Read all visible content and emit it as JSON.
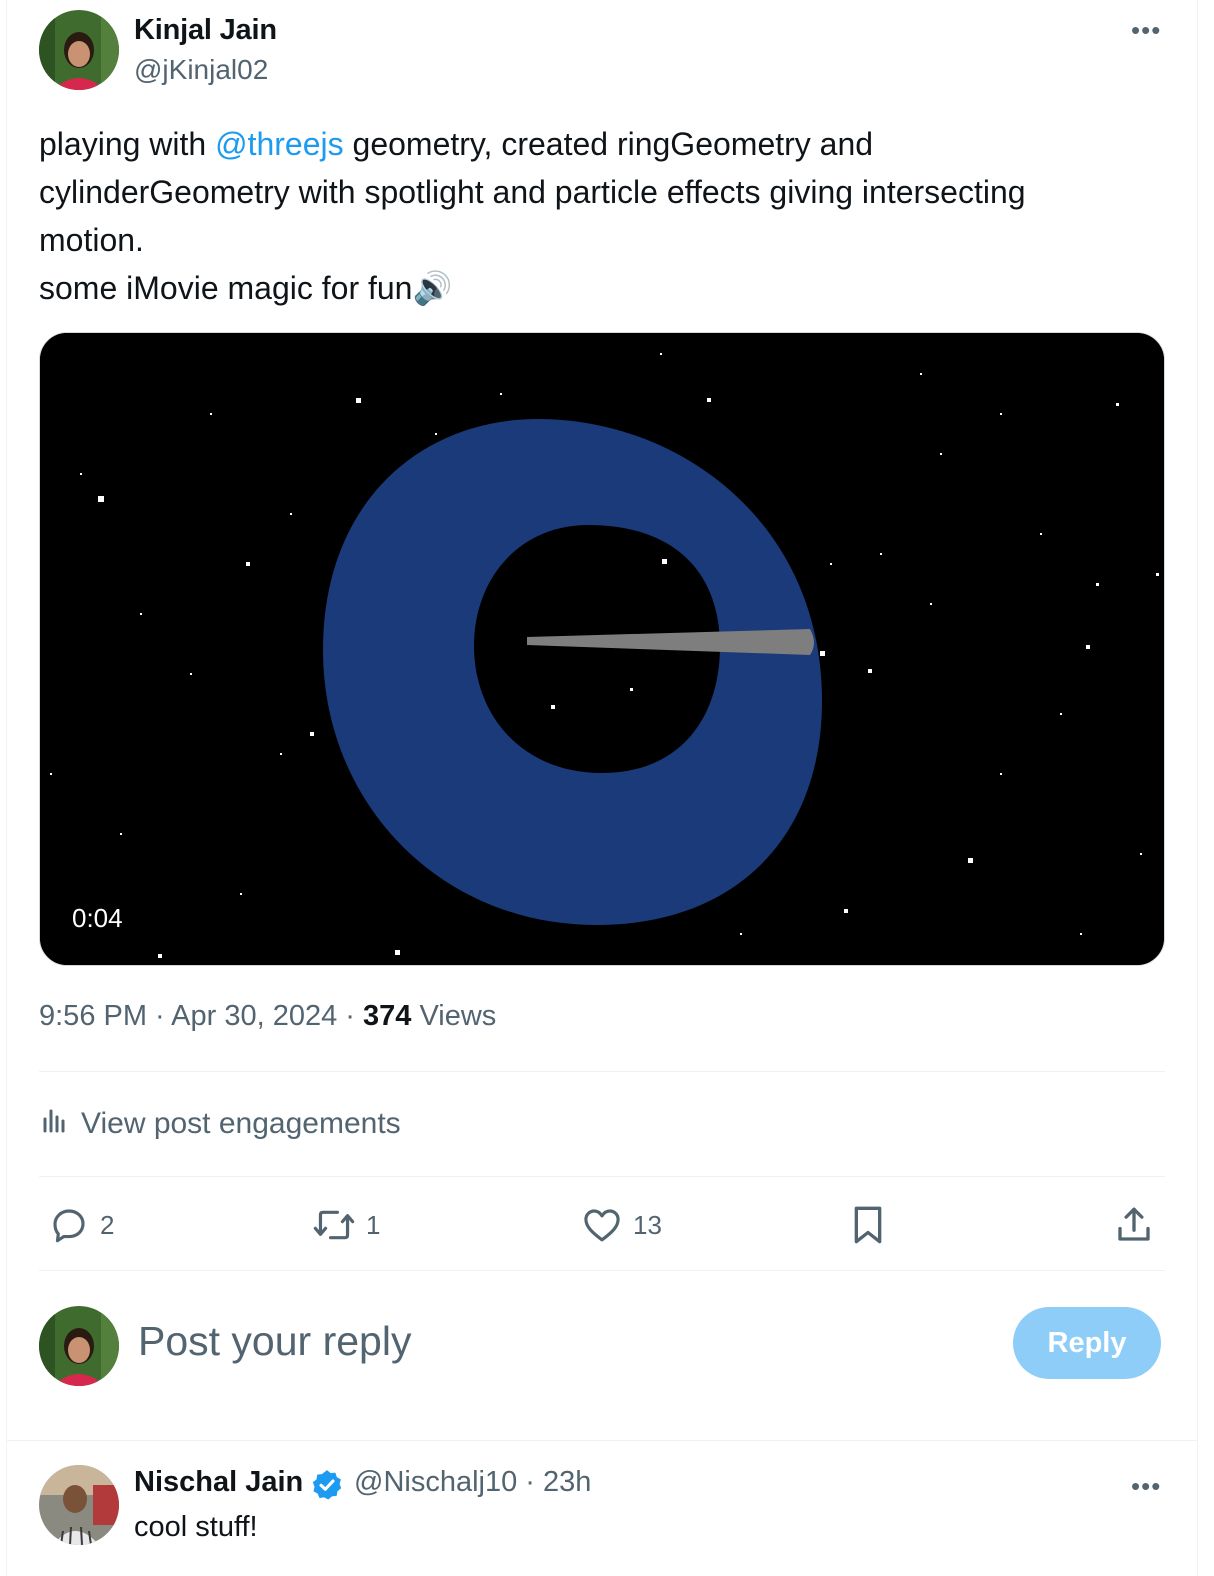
{
  "post": {
    "author": {
      "name": "Kinjal Jain",
      "handle": "@jKinjal02"
    },
    "text": {
      "line1_before": "playing with ",
      "mention": "@threejs",
      "line1_after": " geometry, created ringGeometry and",
      "line2": "cylinderGeometry with spotlight and particle effects giving intersecting",
      "line3": "motion.",
      "line4": " some iMovie magic for fun🔊"
    },
    "video": {
      "duration": "0:04"
    },
    "meta": {
      "time": "9:56 PM",
      "separator1": " · ",
      "date": "Apr 30, 2024",
      "separator2": " · ",
      "views_count": "374",
      "views_label": " Views"
    },
    "engagements_label": "View post engagements",
    "actions": {
      "reply_count": "2",
      "repost_count": "1",
      "like_count": "13"
    }
  },
  "compose": {
    "placeholder": "Post your reply",
    "reply_button": "Reply"
  },
  "reply": {
    "name": "Nischal Jain",
    "handle_time": "@Nischalj10 · 23h",
    "text": "cool stuff!"
  },
  "colors": {
    "accent": "#1d9bf0",
    "secondary_text": "#536471",
    "reply_button": "#8ecdf8",
    "ring": "#1a3a7a"
  },
  "icons": [
    "more-icon",
    "speaker-icon",
    "engagements-icon",
    "reply-icon",
    "repost-icon",
    "like-icon",
    "bookmark-icon",
    "share-icon",
    "verified-icon"
  ]
}
